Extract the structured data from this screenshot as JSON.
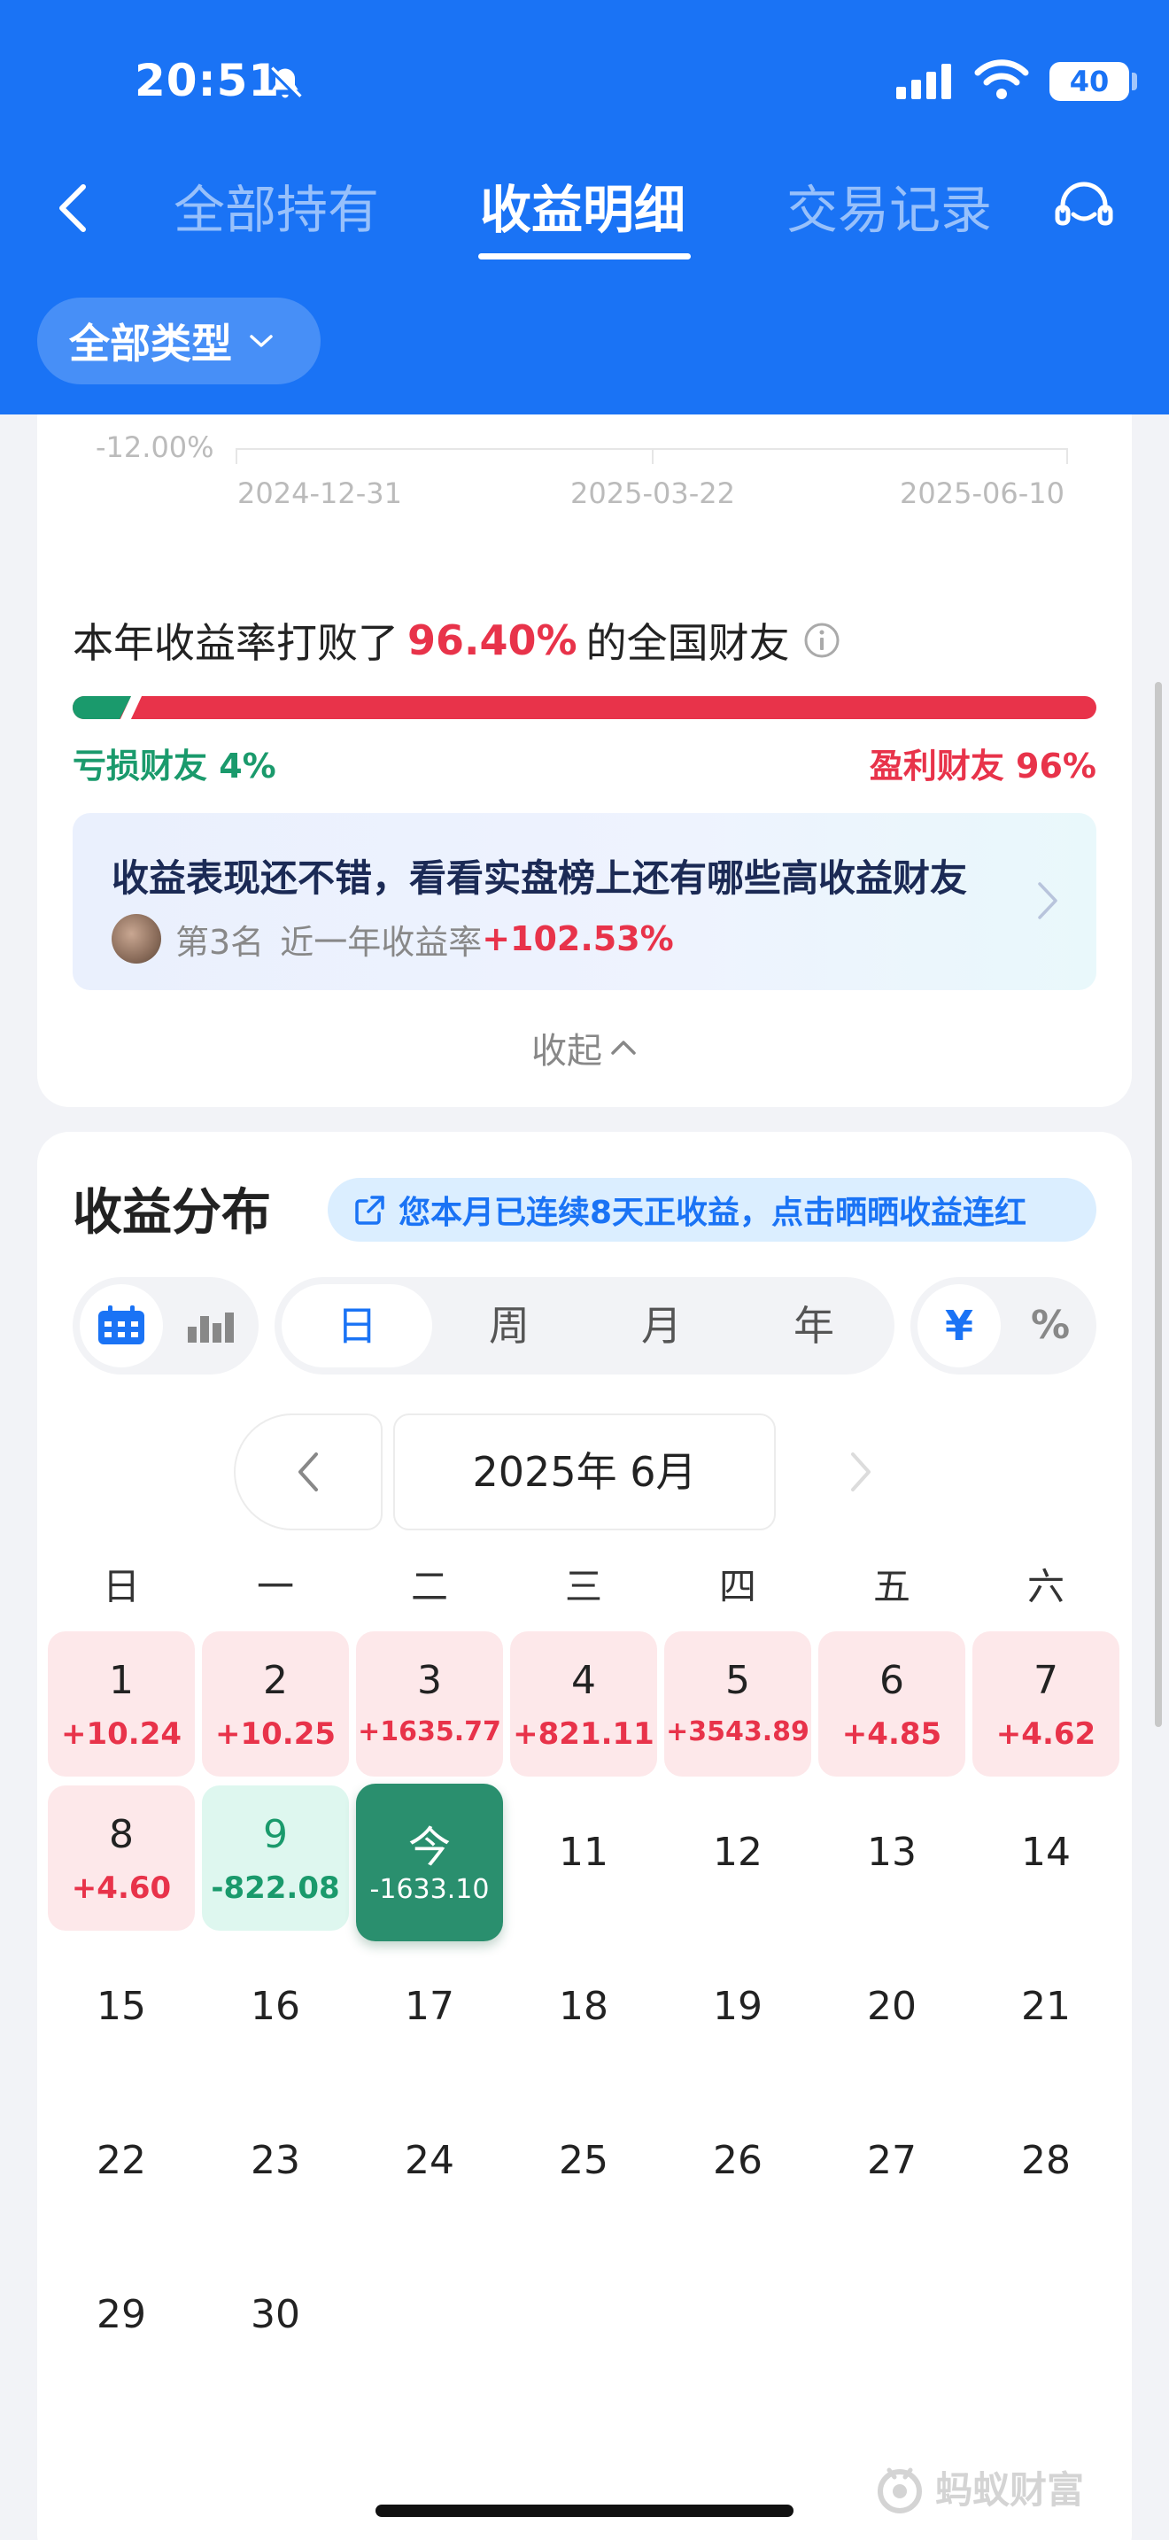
{
  "status": {
    "time": "20:51",
    "battery": "40"
  },
  "nav": {
    "tabs": [
      {
        "label": "全部持有"
      },
      {
        "label": "收益明细"
      },
      {
        "label": "交易记录"
      }
    ],
    "type_filter": "全部类型"
  },
  "chart_axis": {
    "y_label": "-12.00%",
    "x_labels": [
      "2024-12-31",
      "2025-03-22",
      "2025-06-10"
    ]
  },
  "ranking": {
    "prefix": "本年收益率打败了",
    "percent": "96.40%",
    "suffix": "的全国财友",
    "loss_label": "亏损财友 4%",
    "profit_label": "盈利财友 96%",
    "loss_share": 0.04,
    "profit_share": 0.96
  },
  "promo": {
    "title": "收益表现还不错，看看实盘榜上还有哪些高收益财友",
    "rank": "第3名",
    "rate_label": "近一年收益率",
    "rate_value": "+102.53%"
  },
  "collapse_label": "收起",
  "distribution": {
    "title": "收益分布",
    "streak_text": "您本月已连续8天正收益，点击晒晒收益连红",
    "periods": [
      "日",
      "周",
      "月",
      "年"
    ],
    "active_period": "日",
    "unit_currency": "¥",
    "unit_percent": "%",
    "month_label": "2025年 6月",
    "weekdays": [
      "日",
      "一",
      "二",
      "三",
      "四",
      "五",
      "六"
    ],
    "days": [
      {
        "num": "1",
        "val": "+10.24",
        "kind": "pos"
      },
      {
        "num": "2",
        "val": "+10.25",
        "kind": "pos"
      },
      {
        "num": "3",
        "val": "+1635.77",
        "kind": "pos"
      },
      {
        "num": "4",
        "val": "+821.11",
        "kind": "pos"
      },
      {
        "num": "5",
        "val": "+3543.89",
        "kind": "pos"
      },
      {
        "num": "6",
        "val": "+4.85",
        "kind": "pos"
      },
      {
        "num": "7",
        "val": "+4.62",
        "kind": "pos"
      },
      {
        "num": "8",
        "val": "+4.60",
        "kind": "pos"
      },
      {
        "num": "9",
        "val": "-822.08",
        "kind": "neg"
      },
      {
        "num": "今",
        "val": "-1633.10",
        "kind": "today"
      },
      {
        "num": "11",
        "val": "",
        "kind": "empty"
      },
      {
        "num": "12",
        "val": "",
        "kind": "empty"
      },
      {
        "num": "13",
        "val": "",
        "kind": "empty"
      },
      {
        "num": "14",
        "val": "",
        "kind": "empty"
      },
      {
        "num": "15",
        "val": "",
        "kind": "empty"
      },
      {
        "num": "16",
        "val": "",
        "kind": "empty"
      },
      {
        "num": "17",
        "val": "",
        "kind": "empty"
      },
      {
        "num": "18",
        "val": "",
        "kind": "empty"
      },
      {
        "num": "19",
        "val": "",
        "kind": "empty"
      },
      {
        "num": "20",
        "val": "",
        "kind": "empty"
      },
      {
        "num": "21",
        "val": "",
        "kind": "empty"
      },
      {
        "num": "22",
        "val": "",
        "kind": "empty"
      },
      {
        "num": "23",
        "val": "",
        "kind": "empty"
      },
      {
        "num": "24",
        "val": "",
        "kind": "empty"
      },
      {
        "num": "25",
        "val": "",
        "kind": "empty"
      },
      {
        "num": "26",
        "val": "",
        "kind": "empty"
      },
      {
        "num": "27",
        "val": "",
        "kind": "empty"
      },
      {
        "num": "28",
        "val": "",
        "kind": "empty"
      },
      {
        "num": "29",
        "val": "",
        "kind": "empty"
      },
      {
        "num": "30",
        "val": "",
        "kind": "empty"
      }
    ]
  },
  "watermark": "蚂蚁财富",
  "colors": {
    "brand_blue": "#1a73f5",
    "profit_red": "#e8334a",
    "loss_green": "#1a9a6c",
    "today_green": "#2a8f6e"
  }
}
